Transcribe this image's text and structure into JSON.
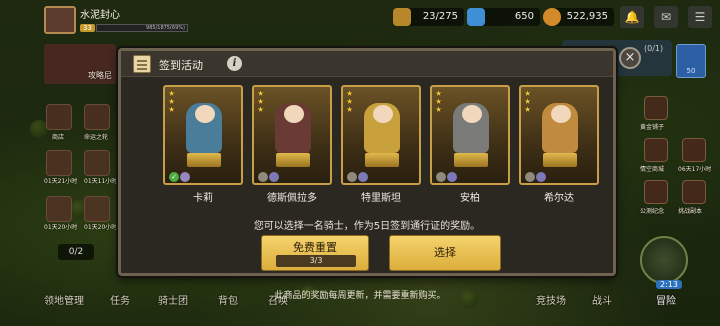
{
  "player": {
    "name": "水泥封心",
    "level": "33",
    "xp_text": "985/1875(69%)"
  },
  "resources": [
    {
      "value": "23/275",
      "icon": "stamina-icon",
      "color": "#b8862b"
    },
    {
      "value": "650",
      "icon": "gem-icon",
      "color": "#3f8fd6"
    },
    {
      "value": "522,935",
      "icon": "gold-coin-icon",
      "color": "#d38b2a"
    }
  ],
  "top_buttons": [
    "bell-icon",
    "mail-icon",
    "menu-icon"
  ],
  "left_menu": [
    "商店",
    "命运之轮",
    "01天21小时",
    "01天11小时",
    "01天20小时",
    "01天20小时",
    "01天21小时",
    "01天20小时"
  ],
  "left_banner": "攻略尼",
  "right_menu": [
    "黄金铺子",
    "情空商城",
    "06天17小时",
    "公测纪念",
    "挑战副本"
  ],
  "right_counter": "(0/1)",
  "right_badge": "50",
  "page_indicator": "0/2",
  "bottom_nav": [
    "领地管理",
    "任务",
    "骑士团",
    "背包",
    "召唤",
    "竞技场",
    "战斗",
    "冒险"
  ],
  "adventure_timer": "2:13",
  "modal": {
    "title": "签到活动",
    "info_symbol": "i",
    "close_symbol": "×",
    "cards": [
      {
        "name": "卡莉",
        "stars": 3,
        "figure_color": "#4a7d9a",
        "check": true
      },
      {
        "name": "德斯佩拉多",
        "stars": 3,
        "figure_color": "#6a3b34",
        "check": false
      },
      {
        "name": "特里斯坦",
        "stars": 3,
        "figure_color": "#c9a13c",
        "check": false
      },
      {
        "name": "安柏",
        "stars": 3,
        "figure_color": "#7a7a78",
        "check": false
      },
      {
        "name": "希尔达",
        "stars": 3,
        "figure_color": "#c08a3f",
        "check": false
      }
    ],
    "instruction": "您可以选择一名骑士，作为5日签到通行证的奖励。",
    "reset_button": {
      "label": "免费重置",
      "count": "3/3"
    },
    "select_button": {
      "label": "选择"
    }
  },
  "footer_note": "此商品的奖励每周更新，并需要重新购买。"
}
